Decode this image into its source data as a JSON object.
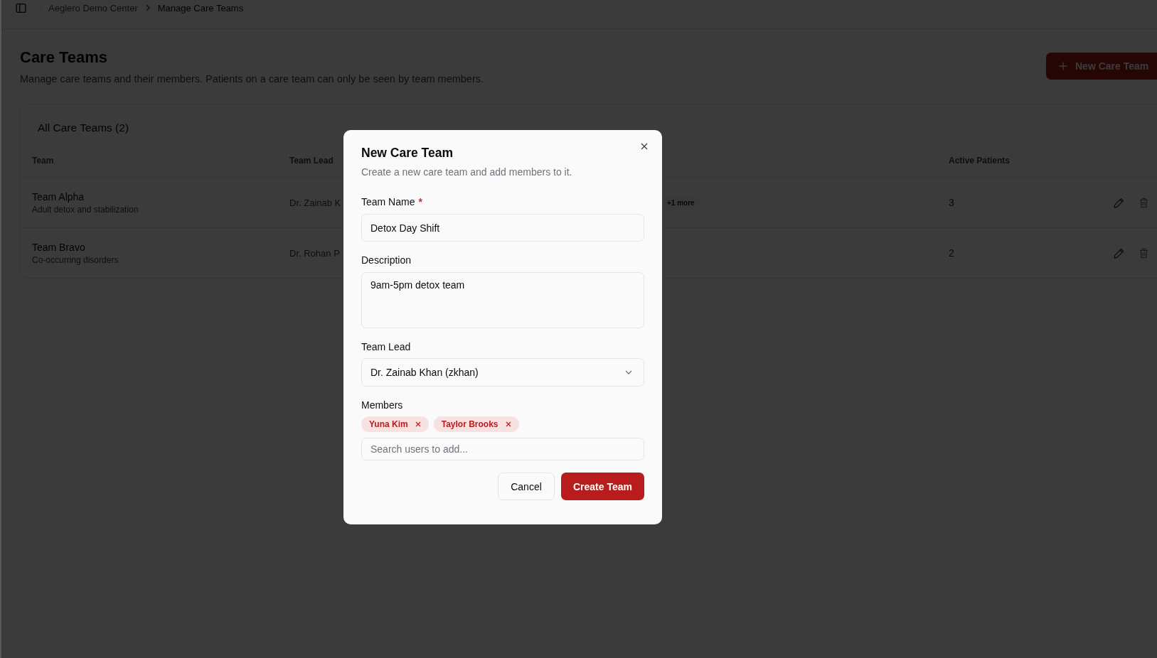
{
  "breadcrumb": [
    {
      "label": "Aeglero Demo Center",
      "current": false
    },
    {
      "label": "Manage Care Teams",
      "current": true
    }
  ],
  "page": {
    "title": "Care Teams",
    "subtitle": "Manage care teams and their members. Patients on a care team can only be seen by team members.",
    "primary_button": "New Care Team"
  },
  "teams_card": {
    "title": "All Care Teams (2)",
    "columns": [
      {
        "label": "Team"
      },
      {
        "label": "Team Lead"
      },
      {
        "label": "Active Patients"
      }
    ],
    "rows": [
      {
        "name": "Team Alpha",
        "description": "Adult detox and stabilization",
        "lead": "Dr. Zainab K",
        "members_more": "+1 more",
        "active_patients": "3"
      },
      {
        "name": "Team Bravo",
        "description": "Co-occurring disorders",
        "lead": "Dr. Rohan P",
        "active_patients": "2"
      }
    ]
  },
  "dialog": {
    "title": "New Care Team",
    "subtitle": "Create a new care team and add members to it.",
    "fields": [
      {
        "kind": "text",
        "label": "Team Name",
        "required_mark": "*",
        "value": "Detox Day Shift"
      },
      {
        "kind": "textarea",
        "label": "Description",
        "value": "9am-5pm detox team"
      },
      {
        "kind": "select",
        "label": "Team Lead",
        "value": "Dr. Zainab Khan (zkhan)"
      },
      {
        "kind": "members",
        "label": "Members",
        "chips": [
          "Yuna Kim",
          "Taylor Brooks"
        ],
        "placeholder": "Search users to add..."
      }
    ],
    "buttons": [
      {
        "kind": "secondary",
        "label": "Cancel"
      },
      {
        "kind": "primary",
        "label": "Create Team"
      }
    ]
  }
}
